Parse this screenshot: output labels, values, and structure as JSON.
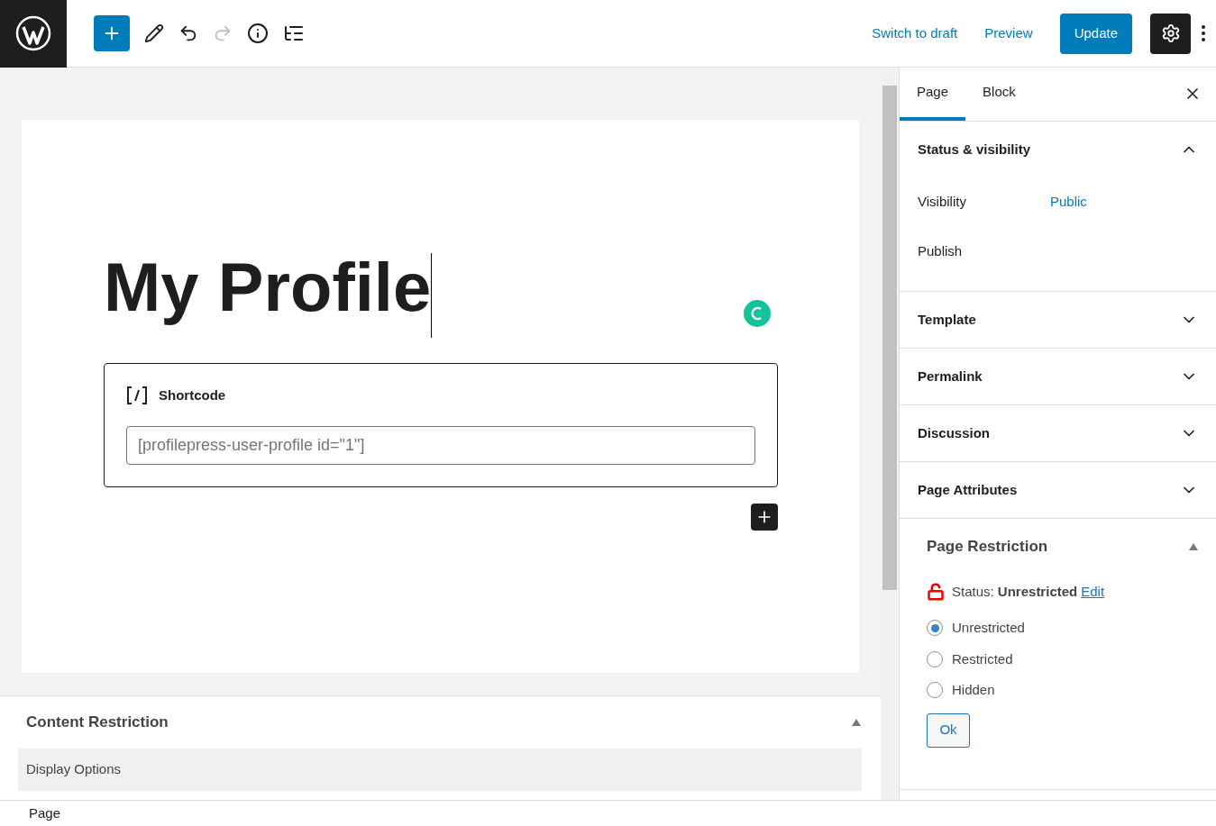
{
  "toolbar": {
    "actions": [
      "Switch to draft",
      "Preview"
    ],
    "primary": "Update",
    "redo_disabled": true
  },
  "editor": {
    "title": "My Profile",
    "block": {
      "label": "Shortcode",
      "value": "[profilepress-user-profile id=\"1\"]"
    }
  },
  "content_restriction": {
    "title": "Content Restriction",
    "expanded": true,
    "section": "Display Options"
  },
  "sidebar": {
    "tabs": [
      {
        "label": "Page",
        "selected": true
      },
      {
        "label": "Block",
        "selected": false
      }
    ],
    "panels": [
      {
        "title": "Status & visibility",
        "expanded": true,
        "rows": [
          {
            "label": "Visibility",
            "value": "Public"
          },
          {
            "label": "Publish"
          }
        ]
      },
      {
        "title": "Template",
        "expanded": false
      },
      {
        "title": "Permalink",
        "expanded": false
      },
      {
        "title": "Discussion",
        "expanded": false
      },
      {
        "title": "Page Attributes",
        "expanded": false
      }
    ],
    "restriction": {
      "title": "Page Restriction",
      "status": "Status: **Unrestricted**",
      "edit": "Edit",
      "options": [
        {
          "label": "Unrestricted",
          "selected": true
        },
        {
          "label": "Restricted",
          "selected": false
        },
        {
          "label": "Hidden",
          "selected": false
        }
      ],
      "button": "Ok"
    }
  },
  "footer": {
    "breadcrumb": "Page"
  }
}
